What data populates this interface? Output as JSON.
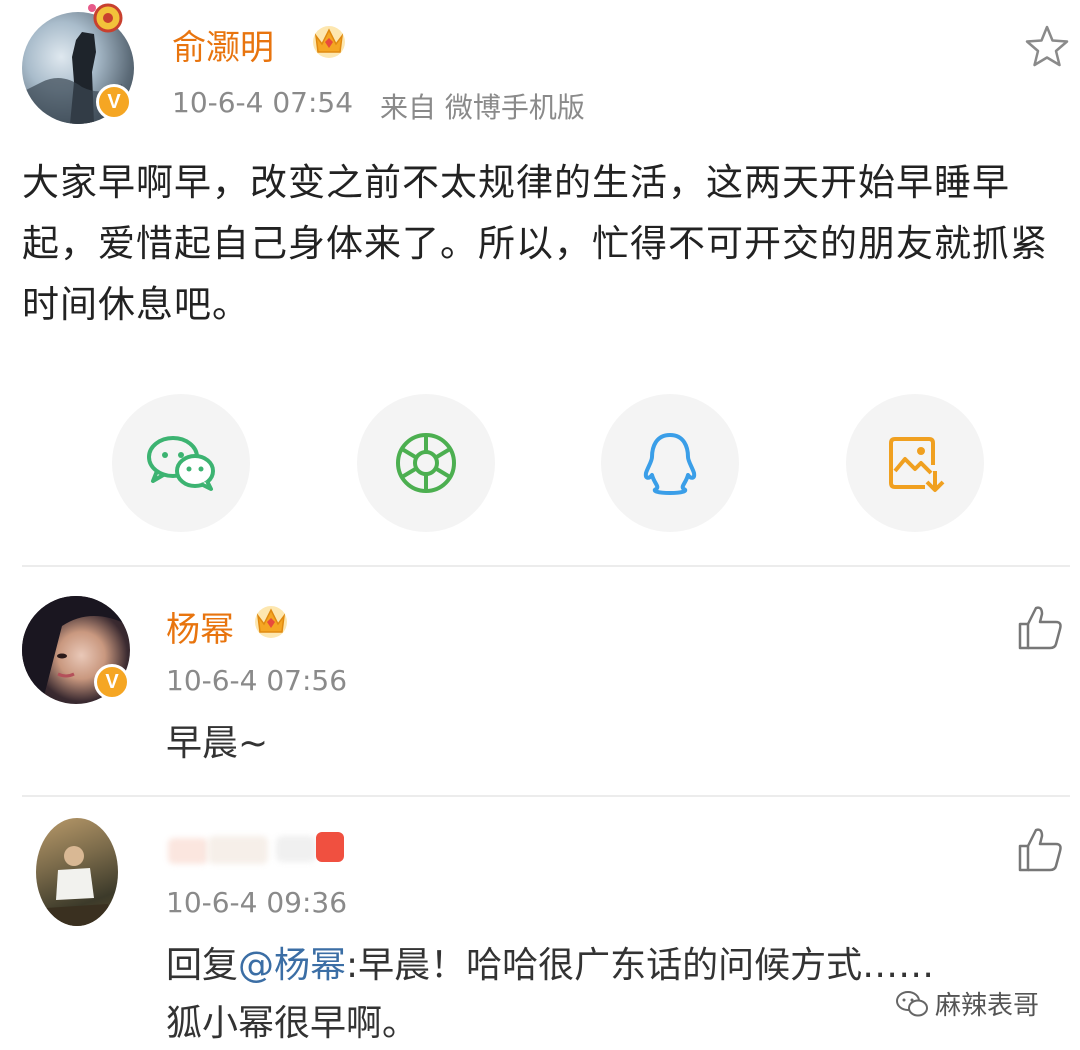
{
  "post": {
    "author": "俞灏明",
    "time": "10-6-4 07:54",
    "source": "来自 微博手机版",
    "text": "大家早啊早，改变之前不太规律的生活，这两天开始早睡早起，爱惜起自己身体来了。所以，忙得不可开交的朋友就抓紧时间休息吧。"
  },
  "share": {
    "items": [
      "wechat-icon",
      "moments-icon",
      "qq-icon",
      "save-image-icon"
    ],
    "colors": {
      "wechat": "#3cb371",
      "moments": "#4caf50",
      "qq": "#3a9ee8",
      "save": "#f0a020"
    }
  },
  "comments": [
    {
      "author": "杨幂",
      "time": "10-6-4 07:56",
      "text": "早晨~"
    },
    {
      "time": "10-6-4 09:36",
      "reply_prefix": "回复",
      "mention": "@杨幂",
      "text_after": ":早晨！哈哈很广东话的问候方式……",
      "text_line2": "狐小幂很早啊。"
    }
  ],
  "watermark": {
    "text": "麻辣表哥"
  },
  "colors": {
    "name": "#e8740e",
    "meta": "#8a8a8a",
    "mention": "#3b6ea5",
    "badge": "#f5a623"
  }
}
